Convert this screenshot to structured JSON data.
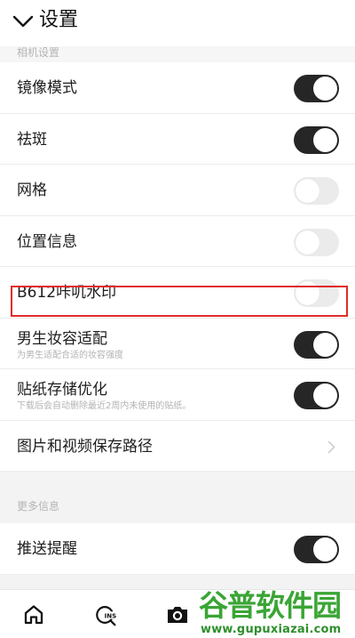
{
  "header": {
    "title": "设置",
    "back_icon": "chevron-down-icon"
  },
  "camera_section": {
    "title": "相机设置",
    "items": [
      {
        "label": "镜像模式",
        "sub": "",
        "on": true
      },
      {
        "label": "祛斑",
        "sub": "",
        "on": true
      },
      {
        "label": "网格",
        "sub": "",
        "on": false
      },
      {
        "label": "位置信息",
        "sub": "",
        "on": false
      },
      {
        "label": "B612咔叽水印",
        "sub": "",
        "on": false
      },
      {
        "label": "男生妆容适配",
        "sub": "为男生适配合适的妆容强度",
        "on": true
      },
      {
        "label": "贴纸存储优化",
        "sub": "下载后会自动删除最近2周内未使用的贴纸。",
        "on": true
      }
    ],
    "save_path": {
      "label": "图片和视频保存路径",
      "icon": "chevron-right-icon"
    }
  },
  "more_section": {
    "title": "更多信息",
    "items": [
      {
        "label": "推送提醒",
        "on": true
      }
    ]
  },
  "bottom_nav": {
    "home_icon": "home-icon",
    "ins_icon": "ins-icon",
    "camera_icon": "camera-icon",
    "ins_text": "INS"
  },
  "watermark": {
    "main": "谷普软件园",
    "url": "www.gupuxiazai.com"
  },
  "colors": {
    "toggle_on": "#262626",
    "toggle_off": "#ebebeb",
    "highlight": "#e02a2a",
    "watermark": "#3aa535"
  }
}
